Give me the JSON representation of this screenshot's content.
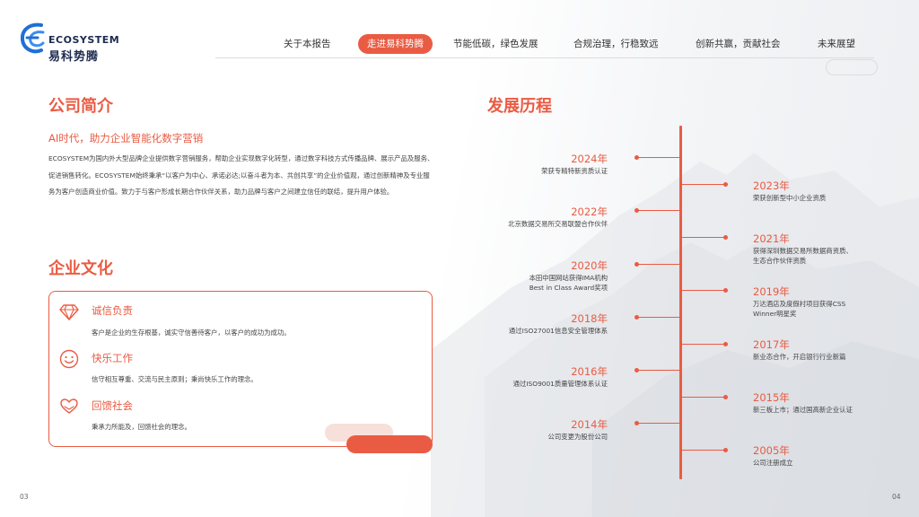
{
  "brand": {
    "name_en": "ECOSYSTEM",
    "name_zh": "易科势腾",
    "accent": "#ea5b43",
    "navy": "#1d2b4f",
    "blue": "#1f6fd6"
  },
  "nav": [
    {
      "label": "关于本报告",
      "active": false
    },
    {
      "label": "走进易科势腾",
      "active": true
    },
    {
      "label": "节能低碳，绿色发展",
      "active": false
    },
    {
      "label": "合规治理，行稳致远",
      "active": false
    },
    {
      "label": "创新共赢，贡献社会",
      "active": false
    },
    {
      "label": "未来展望",
      "active": false
    }
  ],
  "intro": {
    "title": "公司简介",
    "subtitle": "AI时代，助力企业智能化数字营销",
    "paragraph": "ECOSYSTEM为国内外大型品牌企业提供数字营销服务，帮助企业实现数字化转型，通过数字科技方式传播品牌、展示产品及服务、促进销售转化。ECOSYSTEM始终秉承“以客户为中心、承诺必达;以奋斗者为本、共创共享”的企业价值观，通过创新精神及专业服务为客户创造商业价值。致力于与客户形成长期合作伙伴关系，助力品牌与客户之间建立信任的联结，提升用户体验。"
  },
  "culture": {
    "title": "企业文化",
    "items": [
      {
        "icon": "diamond-icon",
        "name": "诚信负责",
        "desc": "客户是企业的生存根基，诚实守信善待客户，以客户的成功为成功。"
      },
      {
        "icon": "smile-icon",
        "name": "快乐工作",
        "desc": "信守相互尊重、交流与民主原则；秉尚快乐工作的理念。"
      },
      {
        "icon": "heart-hands-icon",
        "name": "回馈社会",
        "desc": "秉承力所能及，回馈社会的理念。"
      }
    ]
  },
  "history": {
    "title": "发展历程",
    "events": [
      {
        "year": "2024年",
        "side": "left",
        "lines": [
          "荣获专精特新资质认证"
        ]
      },
      {
        "year": "2023年",
        "side": "right",
        "lines": [
          "荣获创新型中小企业资质"
        ]
      },
      {
        "year": "2022年",
        "side": "left",
        "lines": [
          "北京数据交易所交易联盟合作伙伴"
        ]
      },
      {
        "year": "2021年",
        "side": "right",
        "lines": [
          "获得深圳数据交易所数据商资质、",
          "生态合作伙伴资质"
        ]
      },
      {
        "year": "2020年",
        "side": "left",
        "lines": [
          "本田中国网站获得IMA机构",
          "Best in Class Award奖项"
        ]
      },
      {
        "year": "2019年",
        "side": "right",
        "lines": [
          "万达酒店及度假村项目获得CSS",
          "Winner明星奖"
        ]
      },
      {
        "year": "2018年",
        "side": "left",
        "lines": [
          "通过ISO27001信息安全管理体系"
        ]
      },
      {
        "year": "2017年",
        "side": "right",
        "lines": [
          "新业态合作，开启银行行业新篇"
        ]
      },
      {
        "year": "2016年",
        "side": "left",
        "lines": [
          "通过ISO9001质量管理体系认证"
        ]
      },
      {
        "year": "2015年",
        "side": "right",
        "lines": [
          "新三板上市；通过国高新企业认证"
        ]
      },
      {
        "year": "2014年",
        "side": "left",
        "lines": [
          "公司变更为股份公司"
        ]
      },
      {
        "year": "2005年",
        "side": "right",
        "lines": [
          "公司注册成立"
        ]
      }
    ]
  },
  "pages": {
    "left": "03",
    "right": "04"
  }
}
